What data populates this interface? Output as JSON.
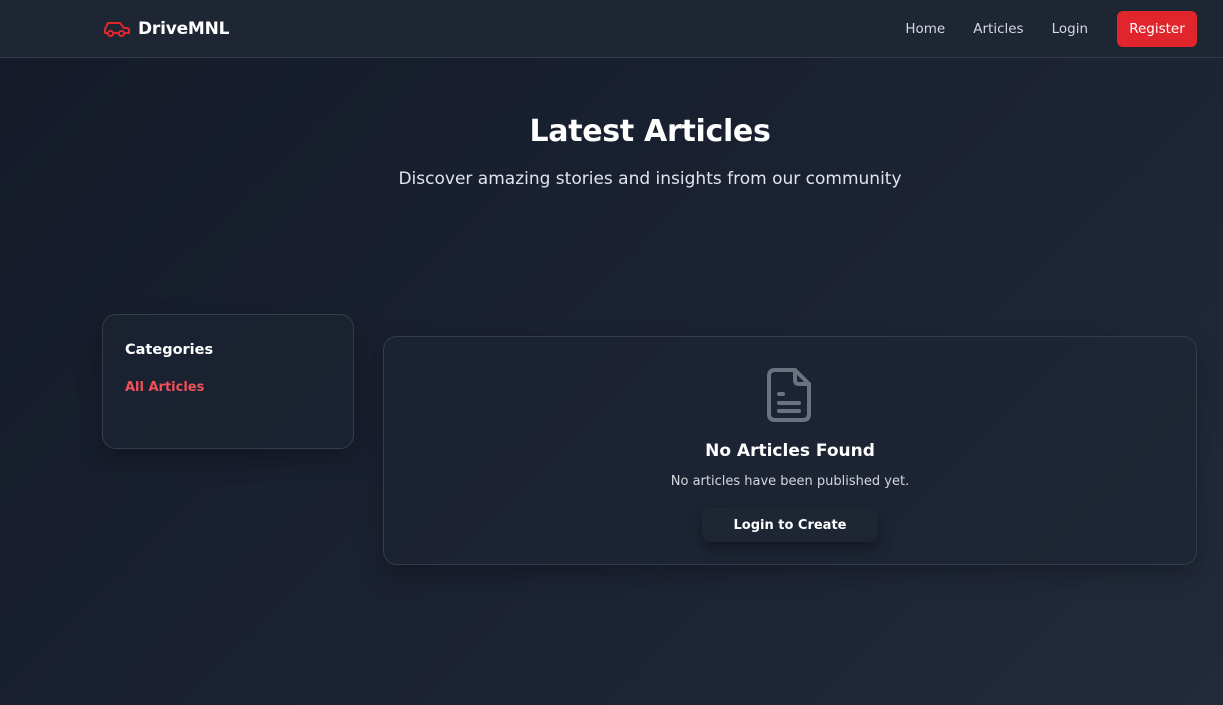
{
  "brand": {
    "name": "DriveMNL",
    "icon": "car-icon",
    "accent": "#e0262c"
  },
  "nav": {
    "links": [
      {
        "label": "Home"
      },
      {
        "label": "Articles"
      },
      {
        "label": "Login"
      }
    ],
    "register_label": "Register"
  },
  "hero": {
    "title": "Latest Articles",
    "subtitle": "Discover amazing stories and insights from our community"
  },
  "sidebar": {
    "title": "Categories",
    "items": [
      {
        "label": "All Articles",
        "active": true
      }
    ]
  },
  "empty_state": {
    "icon": "document-icon",
    "title": "No Articles Found",
    "message": "No articles have been published yet.",
    "button_label": "Login to Create"
  },
  "colors": {
    "background": "#1b2232",
    "navbar": "#1e2533",
    "accent_red": "#e0262c",
    "link_red": "#f0525a"
  }
}
